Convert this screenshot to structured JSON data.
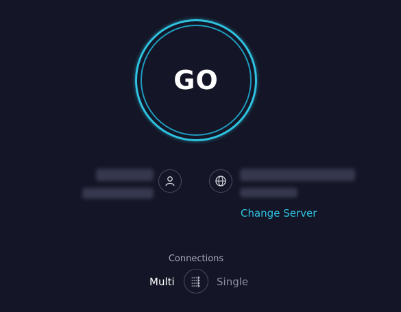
{
  "go": {
    "label": "GO"
  },
  "server": {
    "change_label": "Change Server"
  },
  "connections": {
    "label": "Connections",
    "multi_label": "Multi",
    "single_label": "Single",
    "selected": "Multi"
  },
  "icons": {
    "provider": "user-icon",
    "server": "globe-icon",
    "connections_toggle": "multi-connection-icon"
  },
  "colors": {
    "background": "#141526",
    "accent": "#2ec3e0",
    "text_primary": "#ffffff",
    "text_muted": "#8b8d9f"
  }
}
